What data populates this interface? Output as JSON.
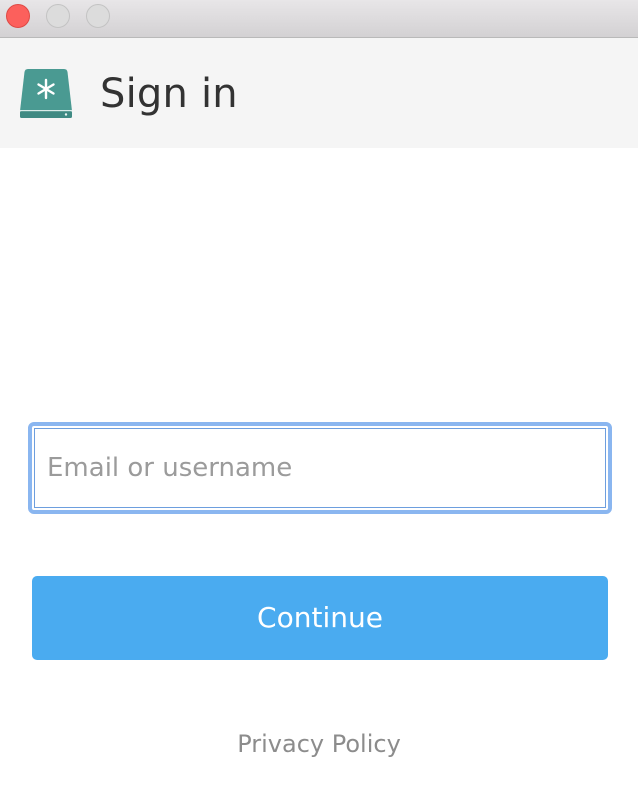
{
  "window": {
    "controls": [
      "close",
      "minimize",
      "maximize"
    ]
  },
  "header": {
    "logo_icon": "drive-asterisk-icon",
    "title": "Sign in"
  },
  "form": {
    "username_value": "",
    "username_placeholder": "Email or username",
    "continue_label": "Continue"
  },
  "footer": {
    "privacy_label": "Privacy Policy"
  },
  "colors": {
    "accent": "#4aabf0",
    "logo": "#4a9a92",
    "focus_ring": "#8ab6f0",
    "close": "#fc605c"
  }
}
